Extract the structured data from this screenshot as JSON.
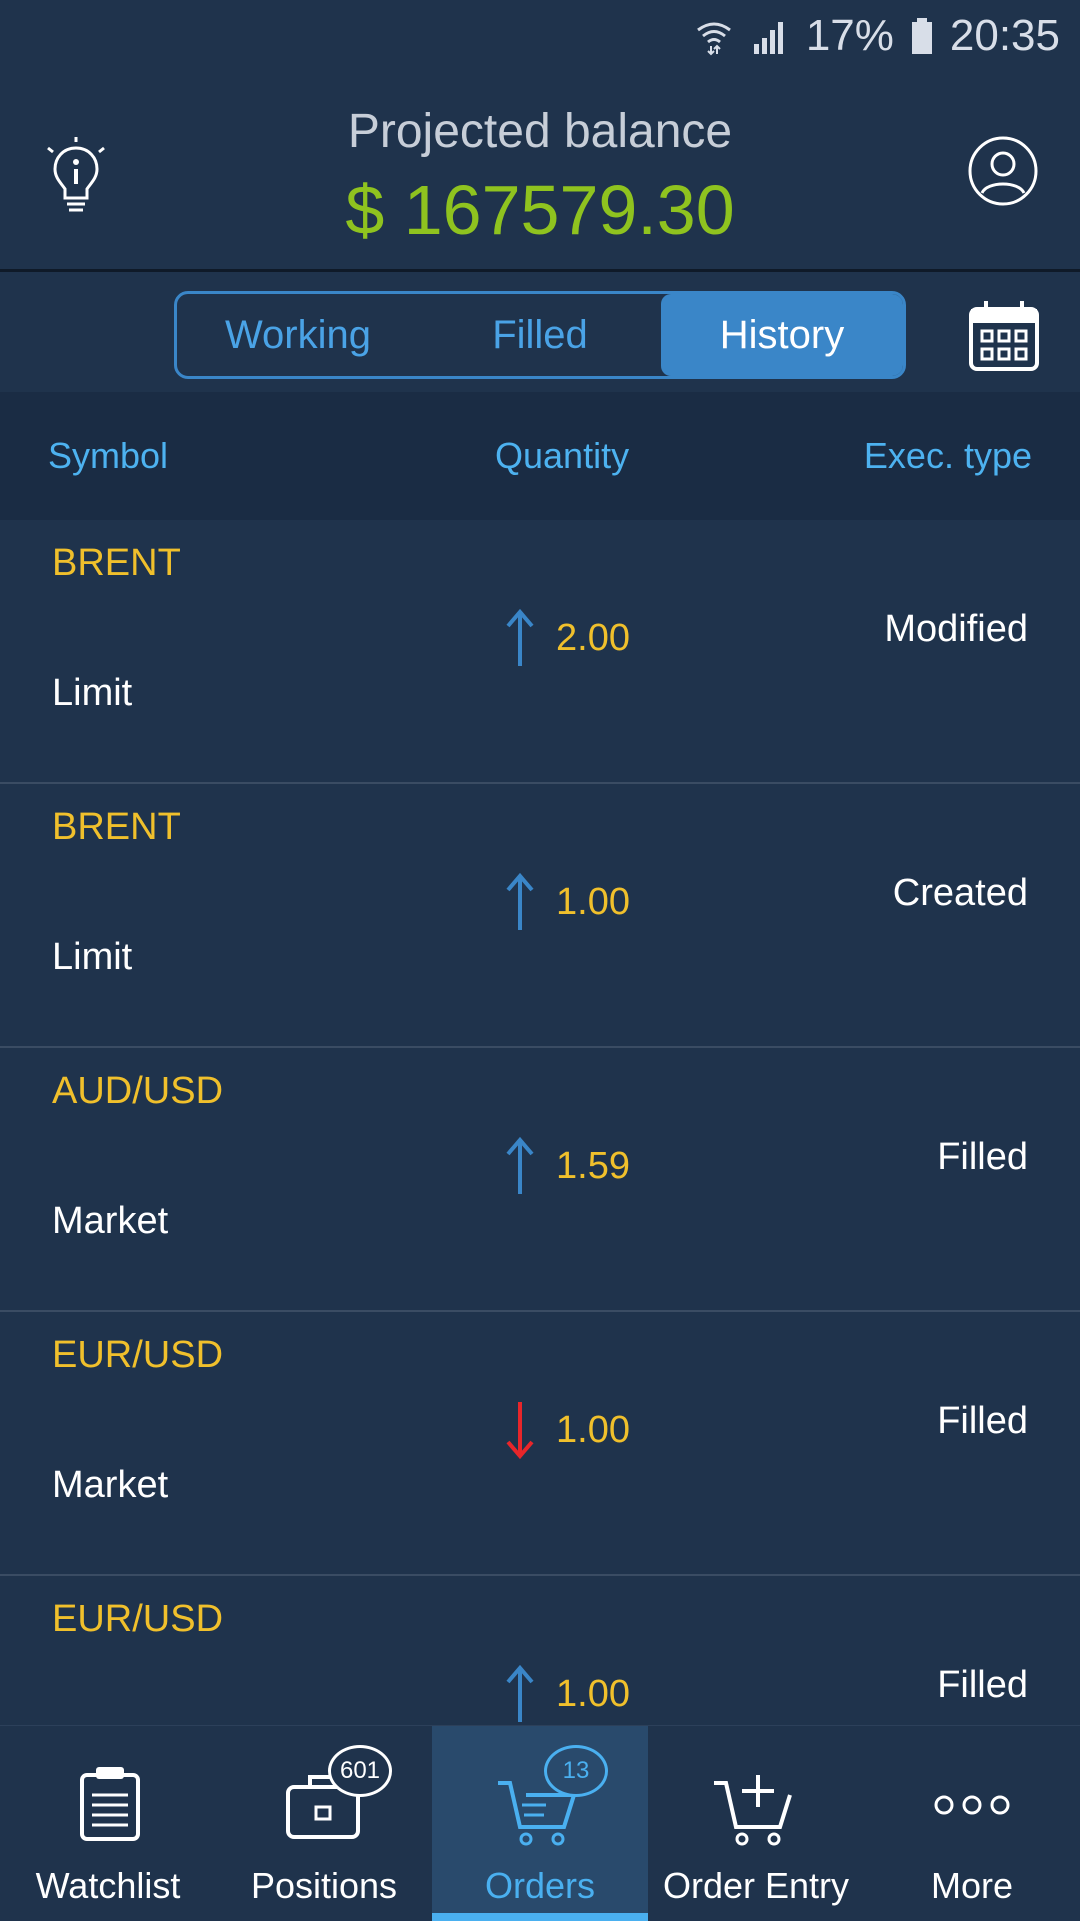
{
  "status_bar": {
    "battery": "17%",
    "time": "20:35"
  },
  "header": {
    "title": "Projected balance",
    "balance": "$ 167579.30"
  },
  "segment": {
    "tabs": [
      "Working",
      "Filled",
      "History"
    ],
    "active": "History"
  },
  "columns": {
    "symbol": "Symbol",
    "quantity": "Quantity",
    "exec_type": "Exec. type"
  },
  "orders": [
    {
      "symbol": "BRENT",
      "order_type": "Limit",
      "direction": "up",
      "quantity": "2.00",
      "exec_type": "Modified"
    },
    {
      "symbol": "BRENT",
      "order_type": "Limit",
      "direction": "up",
      "quantity": "1.00",
      "exec_type": "Created"
    },
    {
      "symbol": "AUD/USD",
      "order_type": "Market",
      "direction": "up",
      "quantity": "1.59",
      "exec_type": "Filled"
    },
    {
      "symbol": "EUR/USD",
      "order_type": "Market",
      "direction": "down",
      "quantity": "1.00",
      "exec_type": "Filled"
    },
    {
      "symbol": "EUR/USD",
      "order_type": "",
      "direction": "up",
      "quantity": "1.00",
      "exec_type": "Filled"
    }
  ],
  "bottom_nav": {
    "items": [
      {
        "label": "Watchlist",
        "icon": "clipboard-icon"
      },
      {
        "label": "Positions",
        "icon": "briefcase-icon",
        "badge": "601"
      },
      {
        "label": "Orders",
        "icon": "cart-icon",
        "badge": "13"
      },
      {
        "label": "Order Entry",
        "icon": "cart-plus-icon"
      },
      {
        "label": "More",
        "icon": "more-icon"
      }
    ],
    "active": "Orders"
  },
  "colors": {
    "background": "#1f334c",
    "accent": "#3a86c8",
    "balance_green": "#8fc31f",
    "symbol_yellow": "#f0c02c",
    "down_red": "#e8262a"
  }
}
